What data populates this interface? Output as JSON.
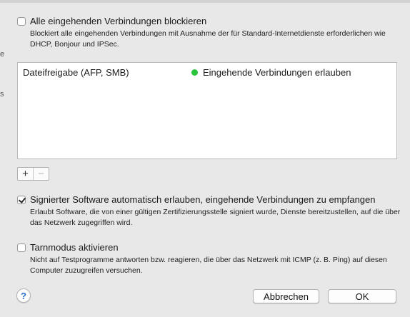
{
  "block_all": {
    "label": "Alle eingehenden Verbindungen blockieren",
    "checked": false,
    "description": "Blockiert alle eingehenden Verbindungen mit Ausnahme der für Standard-Internetdienste erforderlichen wie DHCP, Bonjour und IPSec."
  },
  "services_list": {
    "rows": [
      {
        "service": "Dateifreigabe (AFP, SMB)",
        "status": "Eingehende Verbindungen erlauben",
        "status_color": "#28c43c"
      }
    ]
  },
  "list_controls": {
    "add_label": "+",
    "remove_label": "−"
  },
  "signed_software": {
    "label": "Signierter Software automatisch erlauben, eingehende Verbindungen zu empfangen",
    "checked": true,
    "description": "Erlaubt Software, die von einer gültigen Zertifizierungsstelle signiert wurde, Dienste bereitzustellen, auf die über das Netzwerk zugegriffen wird."
  },
  "stealth_mode": {
    "label": "Tarnmodus aktivieren",
    "checked": false,
    "description": "Nicht auf Testprogramme antworten bzw. reagieren, die über das Netzwerk mit ICMP (z. B. Ping) auf diesen Computer zuzugreifen versuchen."
  },
  "footer": {
    "help_label": "?",
    "cancel_label": "Abbrechen",
    "ok_label": "OK"
  },
  "background_fringe": {
    "line1": "e",
    "line2": "s"
  }
}
